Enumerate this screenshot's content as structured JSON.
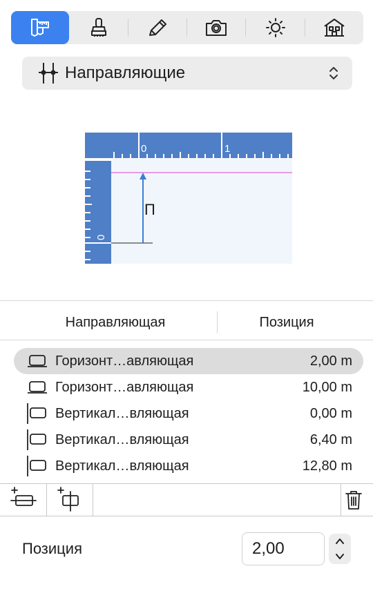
{
  "toolbar": {
    "items": [
      {
        "icon": "caliper-icon",
        "active": true
      },
      {
        "icon": "stamp-icon",
        "active": false
      },
      {
        "icon": "pencil-icon",
        "active": false
      },
      {
        "icon": "camera-icon",
        "active": false
      },
      {
        "icon": "sun-icon",
        "active": false
      },
      {
        "icon": "house-icon",
        "active": false
      }
    ],
    "active_color": "#3b82f0"
  },
  "selector": {
    "label": "Направляющие",
    "icon": "guides-icon"
  },
  "illustration": {
    "ruler_top_labels": [
      "0",
      "1"
    ],
    "ruler_left_label": "0",
    "arrow_label": "П",
    "ruler_color": "#4f7fc6",
    "guide_color": "#e57be0",
    "arrow_color": "#3b7fd8"
  },
  "table": {
    "headers": {
      "name": "Направляющая",
      "position": "Позиция"
    },
    "rows": [
      {
        "type": "horizontal",
        "name": "Горизонт…авляющая",
        "position": "2,00 m",
        "selected": true
      },
      {
        "type": "horizontal",
        "name": "Горизонт…авляющая",
        "position": "10,00 m",
        "selected": false
      },
      {
        "type": "vertical",
        "name": "Вертикал…вляющая",
        "position": "0,00 m",
        "selected": false
      },
      {
        "type": "vertical",
        "name": "Вертикал…вляющая",
        "position": "6,40 m",
        "selected": false
      },
      {
        "type": "vertical",
        "name": "Вертикал…вляющая",
        "position": "12,80 m",
        "selected": false
      }
    ]
  },
  "bottom_bar": {
    "add_horizontal_icon": "add-horizontal-guide-icon",
    "add_vertical_icon": "add-vertical-guide-icon",
    "delete_icon": "trash-icon"
  },
  "position_field": {
    "label": "Позиция",
    "value": "2,00"
  }
}
